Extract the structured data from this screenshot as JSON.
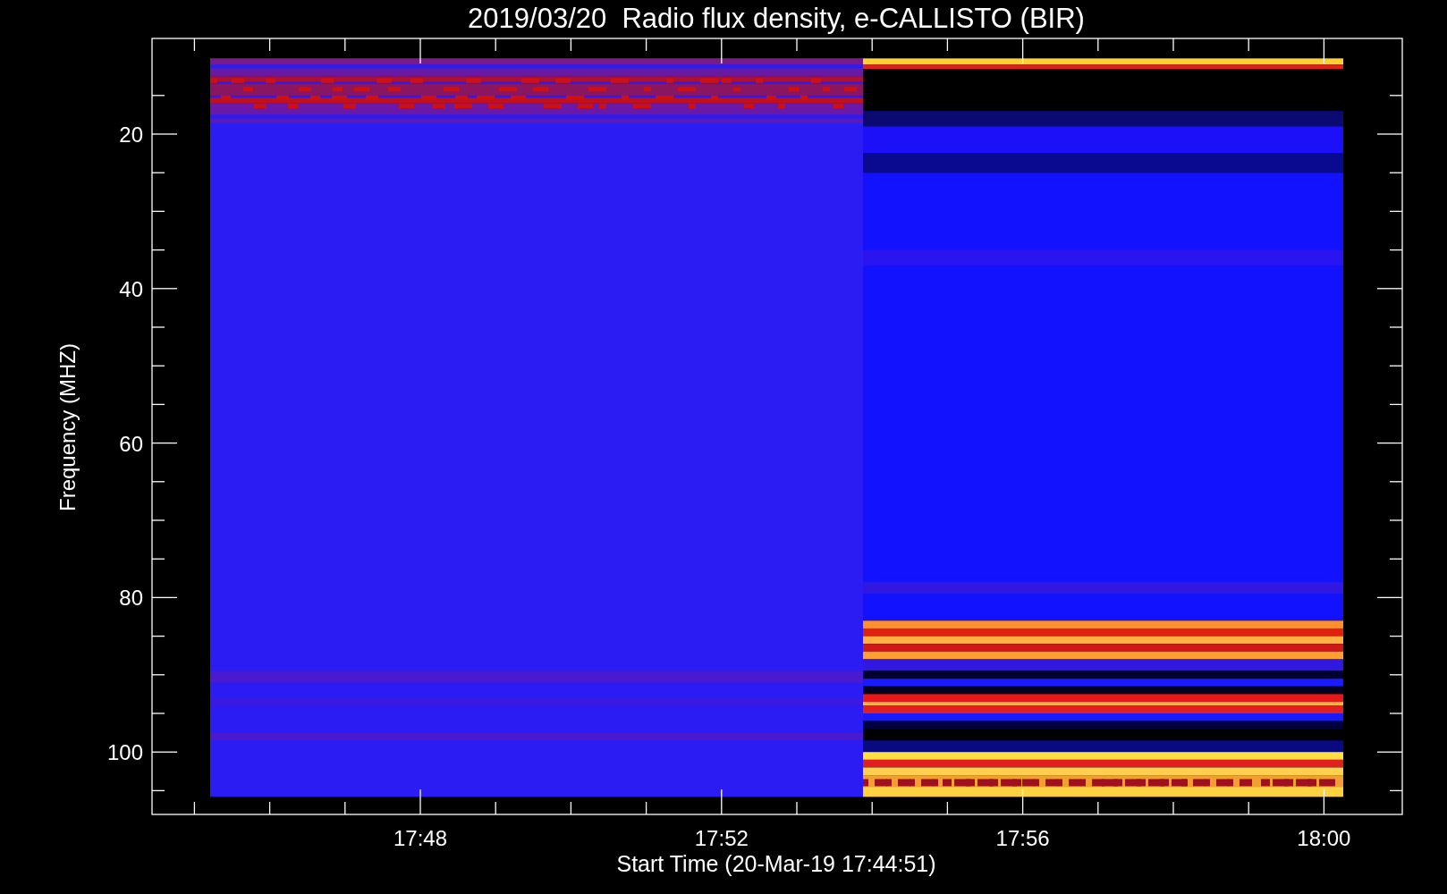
{
  "title": "2019/03/20  Radio flux density, e-CALLISTO (BIR)",
  "y_axis": {
    "label": "Frequency (MHZ)",
    "ticks": [
      "20",
      "40",
      "60",
      "80",
      "100"
    ]
  },
  "x_axis": {
    "label": "Start Time (20-Mar-19 17:44:51)",
    "ticks": [
      "17:48",
      "17:52",
      "17:56",
      "18:00"
    ]
  }
}
